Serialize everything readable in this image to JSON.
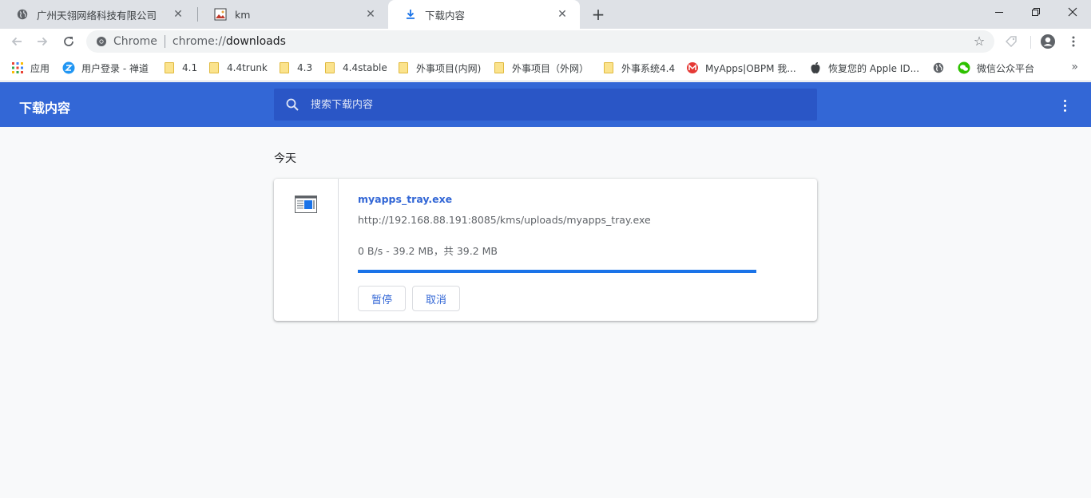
{
  "tabs": [
    {
      "title": "广州天翎网络科技有限公司",
      "icon": "globe-icon"
    },
    {
      "title": "km",
      "icon": "image-icon"
    },
    {
      "title": "下载内容",
      "icon": "download-icon"
    }
  ],
  "toolbar": {
    "site_name": "Chrome",
    "url_scheme": "chrome://",
    "url_path": "downloads"
  },
  "bookmarks": [
    {
      "label": "应用",
      "icon": "apps-grid-icon"
    },
    {
      "label": "用户登录 - 禅道",
      "icon": "zentao-icon"
    },
    {
      "label": "4.1",
      "icon": "folder-icon"
    },
    {
      "label": "4.4trunk",
      "icon": "folder-icon"
    },
    {
      "label": "4.3",
      "icon": "folder-icon"
    },
    {
      "label": "4.4stable",
      "icon": "folder-icon"
    },
    {
      "label": "外事项目(内网)",
      "icon": "folder-icon"
    },
    {
      "label": "外事项目（外网）",
      "icon": "folder-icon"
    },
    {
      "label": "外事系统4.4",
      "icon": "folder-icon"
    },
    {
      "label": "MyApps|OBPM 我...",
      "icon": "myapps-icon"
    },
    {
      "label": "恢复您的 Apple ID...",
      "icon": "apple-icon"
    },
    {
      "label": "",
      "icon": "globe-icon"
    },
    {
      "label": "微信公众平台",
      "icon": "wechat-icon"
    }
  ],
  "downloads": {
    "title": "下载内容",
    "search_placeholder": "搜索下载内容",
    "date_group": "今天",
    "item": {
      "file_name": "myapps_tray.exe",
      "url": "http://192.168.88.191:8085/kms/uploads/myapps_tray.exe",
      "status": "0 B/s - 39.2 MB，共 39.2 MB",
      "progress_fraction": 1.0,
      "pause_label": "暂停",
      "cancel_label": "取消"
    }
  },
  "colors": {
    "header_bg": "#3367d6",
    "search_bg": "#2a56c6",
    "accent": "#1a73e8",
    "link": "#3367d6"
  }
}
